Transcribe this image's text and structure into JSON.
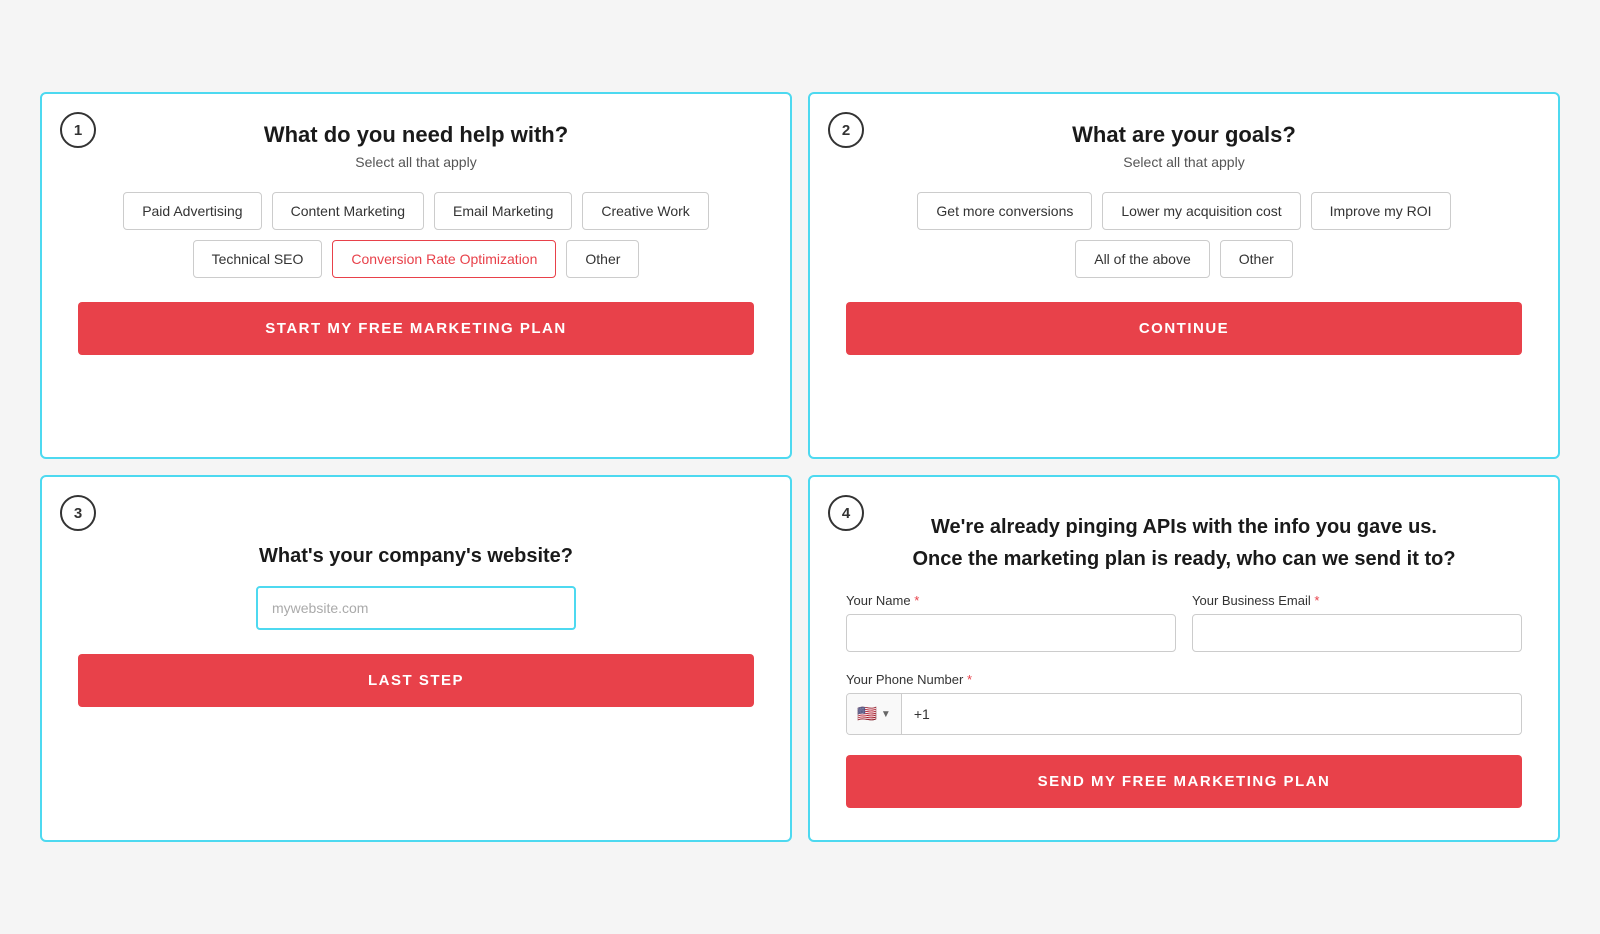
{
  "card1": {
    "step": "1",
    "title": "What do you need help with?",
    "subtitle": "Select all that apply",
    "options": [
      {
        "label": "Paid Advertising",
        "selected": false
      },
      {
        "label": "Content Marketing",
        "selected": false
      },
      {
        "label": "Email Marketing",
        "selected": false
      },
      {
        "label": "Creative Work",
        "selected": false
      },
      {
        "label": "Technical SEO",
        "selected": false
      },
      {
        "label": "Conversion Rate Optimization",
        "selected": true
      },
      {
        "label": "Other",
        "selected": false
      }
    ],
    "cta_label": "START MY FREE MARKETING PLAN"
  },
  "card2": {
    "step": "2",
    "title": "What are your goals?",
    "subtitle": "Select all that apply",
    "options": [
      {
        "label": "Get more conversions",
        "selected": false
      },
      {
        "label": "Lower my acquisition cost",
        "selected": false
      },
      {
        "label": "Improve my ROI",
        "selected": false
      },
      {
        "label": "All of the above",
        "selected": false
      },
      {
        "label": "Other",
        "selected": false
      }
    ],
    "cta_label": "CONTINUE"
  },
  "card3": {
    "step": "3",
    "question": "What's your company's website?",
    "input_placeholder": "mywebsite.com",
    "cta_label": "LAST STEP"
  },
  "card4": {
    "step": "4",
    "title_line1": "We're already pinging APIs with the info you gave us.",
    "title_line2": "Once the marketing plan is ready, who can we send it to?",
    "name_label": "Your Name",
    "email_label": "Your Business Email",
    "phone_label": "Your Phone Number",
    "name_placeholder": "",
    "email_placeholder": "",
    "phone_prefix": "+1",
    "flag_emoji": "🇺🇸",
    "cta_label": "SEND MY FREE MARKETING PLAN",
    "required_mark": "*"
  }
}
